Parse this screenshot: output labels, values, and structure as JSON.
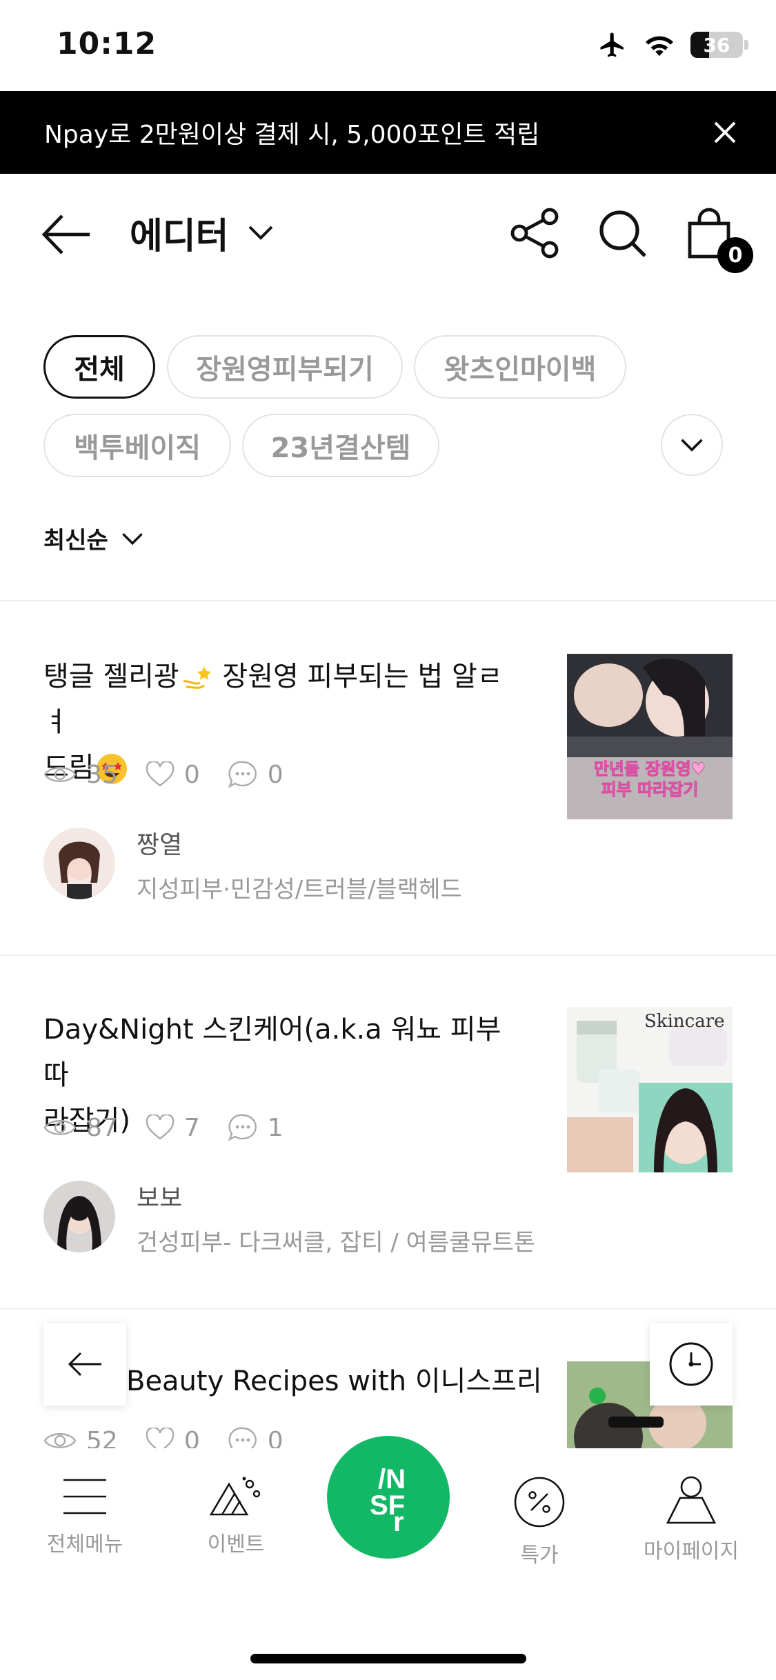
{
  "status_bar": {
    "time": "10:12",
    "battery": "36",
    "battery_level": 0.36
  },
  "promo": {
    "text": "Npay로 2만원이상 결제 시, 5,000포인트 적립"
  },
  "header": {
    "title": "에디터",
    "cart_count": "0"
  },
  "chips": [
    {
      "label": "전체",
      "active": true
    },
    {
      "label": "장원영피부되기",
      "active": false
    },
    {
      "label": "왓츠인마이백",
      "active": false
    },
    {
      "label": "백투베이직",
      "active": false
    },
    {
      "label": "23년결산템",
      "active": false
    }
  ],
  "sort": {
    "label": "최신순"
  },
  "articles": [
    {
      "title_line1": "탱글 젤리광",
      "title_line1b": " 장원영 피부되는 법 알ㄹ ㅕ",
      "title_line2": "드림",
      "views": "35",
      "likes": "0",
      "comments": "0",
      "author": "짱열",
      "author_desc": "지성피부·민감성/트러블/블랙헤드",
      "thumb_text_1": "만년돌 장원영♥",
      "thumb_text_2": "피부 따라잡기"
    },
    {
      "title_line1": "Day&Night 스킨케어(a.k.a 워뇨 피부 따",
      "title_line2": "라잡기)",
      "views": "87",
      "likes": "7",
      "comments": "1",
      "author": "보보",
      "author_desc": "건성피부- 다크써클, 잡티 / 여름쿨뮤트톤",
      "thumb_text_1": "Skincare"
    },
    {
      "title_line1": "Beauty Recipes with 이니스프리",
      "views": "52",
      "likes": "0",
      "comments": "0"
    }
  ],
  "bottom_nav": {
    "menu": "전체메뉴",
    "events": "이벤트",
    "center": "/N SF r",
    "sale": "특가",
    "mypage": "마이페이지"
  },
  "colors": {
    "accent": "#12b866",
    "promo_bg": "#000000"
  }
}
